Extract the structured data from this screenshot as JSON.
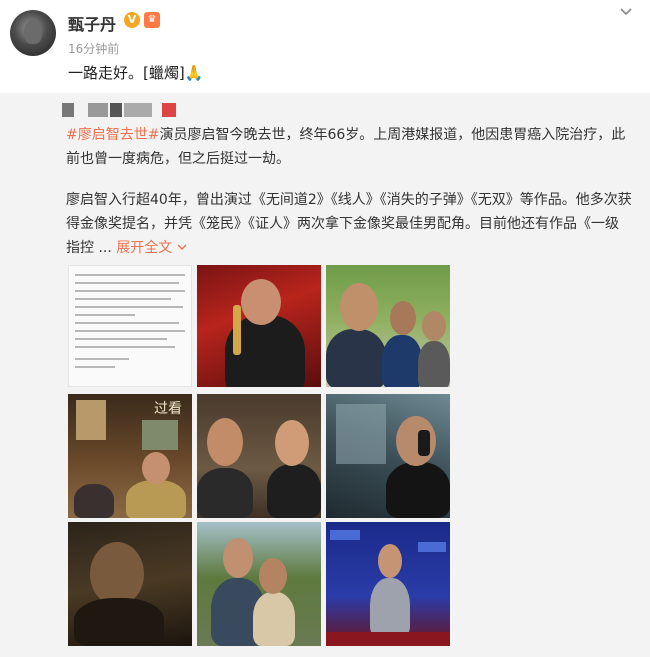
{
  "post": {
    "username": "甄子丹",
    "verified_badge": "V",
    "time": "16分钟前",
    "text": "一路走好。[蠟燭]🙏",
    "icons": [
      "avatar",
      "verified-icon",
      "level-icon",
      "chevron-down-icon"
    ]
  },
  "repost": {
    "topic": "#廖启智去世#",
    "line1": "演员廖启智今晚去世，终年66岁。上周港媒报道，他因患胃癌入院治疗，此前也曾一度病危，但之后挺过一劫。",
    "line2": "廖启智入行超40年，曾出演过《无间道2》《线人》《消失的子弹》《无双》等作品。他多次获得金像奖提名，并凭《笼民》《证人》两次拿下金像奖最佳男配角。目前他还有作品《一级指控 ... ",
    "expand_label": "展开全文",
    "photos": [
      {
        "name": "notice-photo",
        "kind": "notice"
      },
      {
        "name": "award-photo",
        "kind": "photo"
      },
      {
        "name": "group-selfie-photo",
        "kind": "photo"
      },
      {
        "name": "restaurant-scene-photo",
        "kind": "photo",
        "caption": "过看"
      },
      {
        "name": "two-men-scene-photo",
        "kind": "photo"
      },
      {
        "name": "phone-call-photo",
        "kind": "photo"
      },
      {
        "name": "dark-scene-photo",
        "kind": "photo"
      },
      {
        "name": "outdoor-scene-photo",
        "kind": "photo"
      },
      {
        "name": "red-carpet-photo",
        "kind": "photo"
      }
    ]
  },
  "colors": {
    "accent": "#eb7350",
    "repost_bg": "#f3f3f3",
    "text": "#333333",
    "muted": "#999999"
  }
}
